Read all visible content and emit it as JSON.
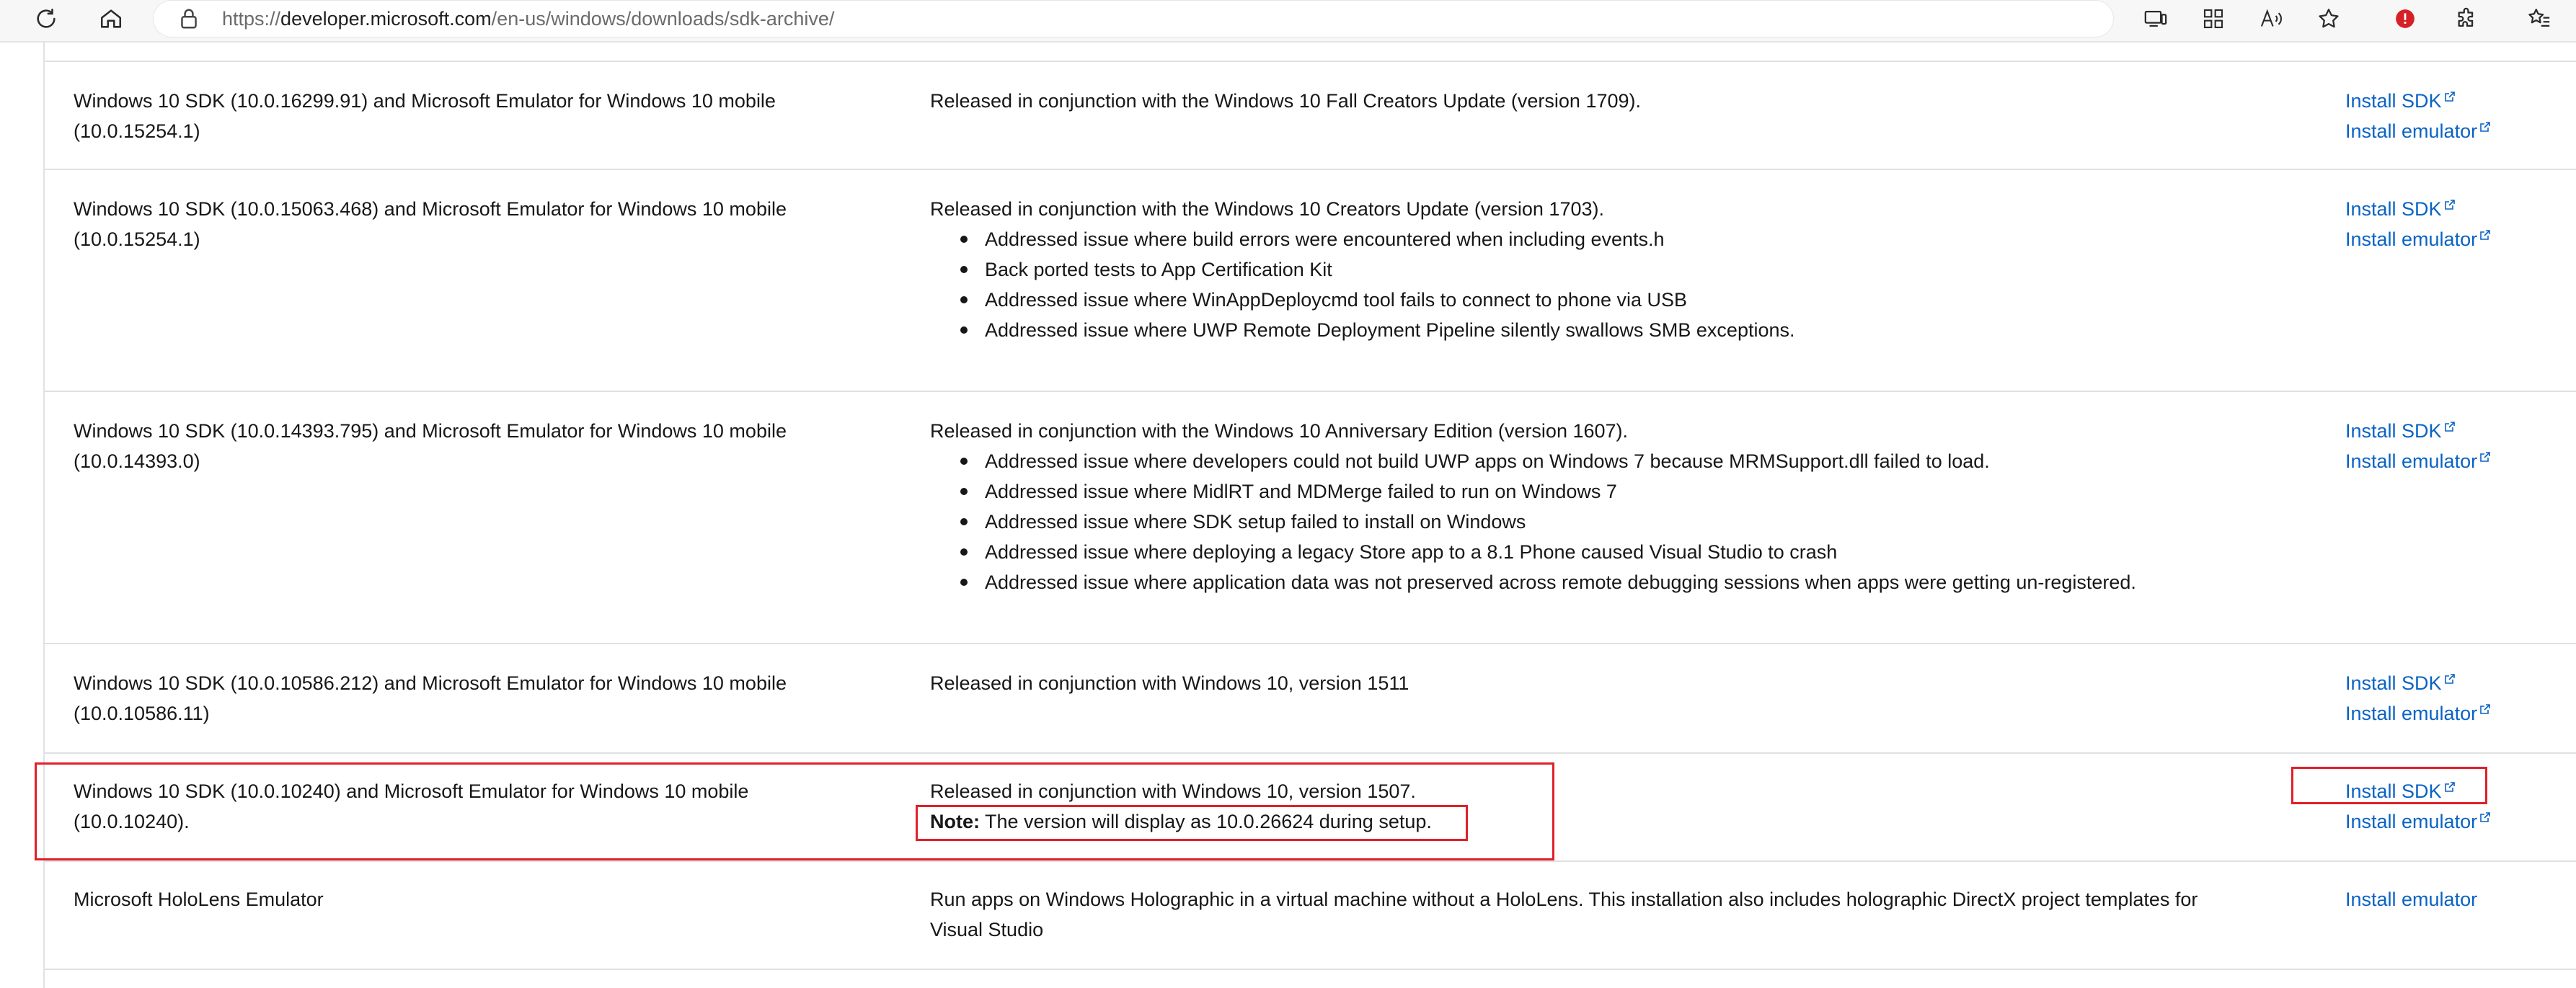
{
  "browser": {
    "url_prefix": "https://",
    "url_domain": "developer.microsoft.com",
    "url_path": "/en-us/windows/downloads/sdk-archive/"
  },
  "rows": [
    {
      "name_line1": "Windows 10 SDK (10.0.16299.91) and Microsoft Emulator for Windows 10 mobile",
      "name_line2": "(10.0.15254.1)",
      "description": "Released in conjunction with the Windows 10 Fall Creators Update (version 1709).",
      "bullets": [],
      "links": [
        "Install SDK",
        "Install emulator"
      ]
    },
    {
      "name_line1": "Windows 10 SDK (10.0.15063.468) and Microsoft Emulator for Windows 10 mobile",
      "name_line2": "(10.0.15254.1)",
      "description": "Released in conjunction with the Windows 10 Creators Update (version 1703).",
      "bullets": [
        "Addressed issue where build errors were encountered when including events.h",
        "Back ported tests to App Certification Kit",
        "Addressed issue where WinAppDeploycmd tool fails to connect to phone via USB",
        "Addressed issue where UWP Remote Deployment Pipeline silently swallows SMB exceptions."
      ],
      "links": [
        "Install SDK",
        "Install emulator"
      ]
    },
    {
      "name_line1": "Windows 10 SDK (10.0.14393.795) and Microsoft Emulator for Windows 10 mobile",
      "name_line2": "(10.0.14393.0)",
      "description": "Released in conjunction with the Windows 10 Anniversary Edition (version 1607).",
      "bullets": [
        "Addressed issue where developers could not build UWP apps on Windows 7 because MRMSupport.dll failed to load.",
        "Addressed issue where MidlRT and MDMerge failed to run on Windows 7",
        "Addressed issue where SDK setup failed to install on Windows",
        "Addressed issue where deploying a legacy Store app to a 8.1 Phone caused Visual Studio to crash",
        "Addressed issue where application data was not preserved across remote debugging sessions when apps were getting un-registered."
      ],
      "links": [
        "Install SDK",
        "Install emulator"
      ]
    },
    {
      "name_line1": "Windows 10 SDK (10.0.10586.212) and Microsoft Emulator for Windows 10 mobile",
      "name_line2": "(10.0.10586.11)",
      "description": "Released in conjunction with Windows 10, version 1511",
      "bullets": [],
      "links": [
        "Install SDK",
        "Install emulator"
      ]
    },
    {
      "name_line1": "Windows 10 SDK (10.0.10240) and Microsoft Emulator for Windows 10 mobile",
      "name_line2": "(10.0.10240).",
      "description": "Released in conjunction with Windows 10, version 1507.",
      "note_label": "Note:",
      "note_text": " The version will display as 10.0.26624 during setup.",
      "bullets": [],
      "links": [
        "Install SDK",
        "Install emulator"
      ]
    },
    {
      "name_line1": "Microsoft HoloLens Emulator",
      "name_line2": "",
      "description": "Run apps on Windows Holographic in a virtual machine without a HoloLens. This installation also includes holographic DirectX project templates for",
      "description_line2": "Visual Studio",
      "bullets": [],
      "links": [
        "Install emulator"
      ]
    }
  ],
  "highlight_color": "#e0202a",
  "link_color": "#0b63c4",
  "icons": [
    "refresh-icon",
    "home-icon",
    "lock-icon",
    "device-icon",
    "apps-icon",
    "read-aloud-icon",
    "favorite-star-icon",
    "alert-icon",
    "extensions-icon",
    "favorites-icon",
    "external-link-icon"
  ]
}
